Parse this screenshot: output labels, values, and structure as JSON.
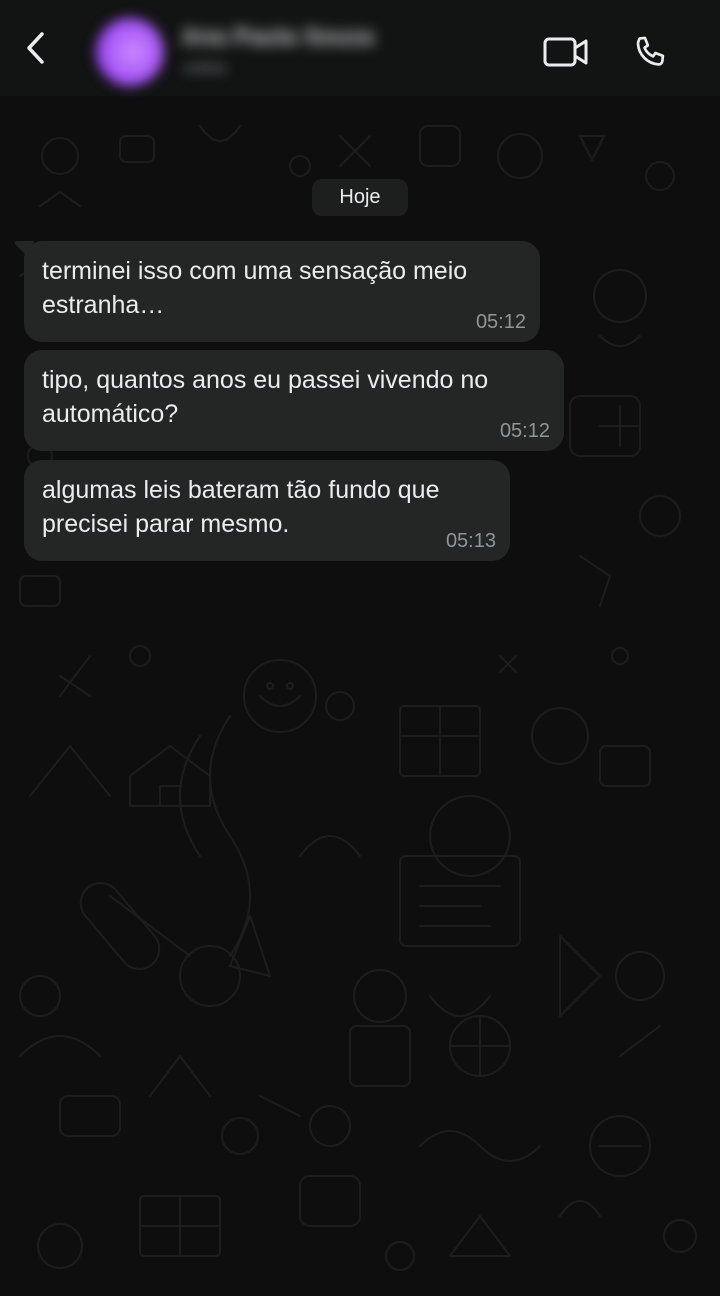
{
  "header": {
    "back_icon": "chevron-left-icon",
    "contact_name": "Ana Paula Souza",
    "contact_status": "online",
    "avatar_color": "#a855f7",
    "video_icon": "video-camera-icon",
    "call_icon": "phone-icon"
  },
  "chat": {
    "date_label": "Hoje",
    "messages": [
      {
        "text": "terminei isso com uma sensação meio\nestranha…",
        "time": "05:12",
        "direction": "incoming"
      },
      {
        "text": "tipo, quantos anos eu passei vivendo no\nautomático?",
        "time": "05:12",
        "direction": "incoming"
      },
      {
        "text": "algumas leis bateram tão fundo que\nprecisei parar mesmo.",
        "time": "05:13",
        "direction": "incoming"
      }
    ]
  },
  "colors": {
    "header_bg": "#121313",
    "chat_bg": "#0e0e0e",
    "bubble_bg": "#242626",
    "text": "#e9edef",
    "timestamp": "#8e9699"
  }
}
